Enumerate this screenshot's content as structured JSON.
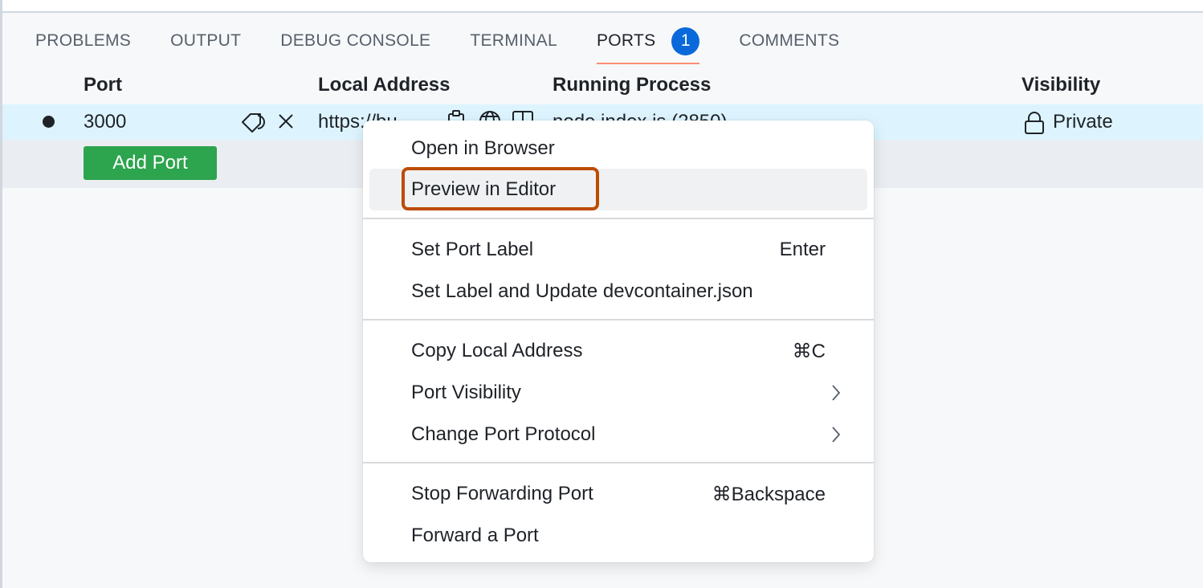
{
  "panel": {
    "tabs": [
      {
        "label": "PROBLEMS",
        "active": false
      },
      {
        "label": "OUTPUT",
        "active": false
      },
      {
        "label": "DEBUG CONSOLE",
        "active": false
      },
      {
        "label": "TERMINAL",
        "active": false
      },
      {
        "label": "PORTS",
        "active": true,
        "badge": "1"
      },
      {
        "label": "COMMENTS",
        "active": false
      }
    ],
    "accent_color": "#fd8c73",
    "badge_color": "#0969da"
  },
  "ports_table": {
    "columns": [
      "Port",
      "Local Address",
      "Running Process",
      "Visibility"
    ],
    "rows": [
      {
        "status_icon": "running-dot",
        "port": "3000",
        "local_address": "https://bu",
        "running_process": "node index.js (2850)",
        "visibility": "Private",
        "row_icons": [
          "tag-icon",
          "close-icon",
          "copy-icon",
          "globe-icon",
          "preview-icon"
        ]
      }
    ],
    "add_port_label": "Add Port",
    "add_port_color": "#2da44e"
  },
  "context_menu": {
    "groups": [
      [
        {
          "label": "Open in Browser",
          "shortcut": ""
        },
        {
          "label": "Preview in Editor",
          "shortcut": "",
          "highlighted": true
        }
      ],
      [
        {
          "label": "Set Port Label",
          "shortcut": "Enter"
        },
        {
          "label": "Set Label and Update devcontainer.json",
          "shortcut": ""
        }
      ],
      [
        {
          "label": "Copy Local Address",
          "shortcut": "⌘C"
        },
        {
          "label": "Port Visibility",
          "shortcut": "",
          "submenu": true
        },
        {
          "label": "Change Port Protocol",
          "shortcut": "",
          "submenu": true
        }
      ],
      [
        {
          "label": "Stop Forwarding Port",
          "shortcut": "⌘Backspace"
        },
        {
          "label": "Forward a Port",
          "shortcut": ""
        }
      ]
    ],
    "highlight_color": "#bc4c00"
  }
}
